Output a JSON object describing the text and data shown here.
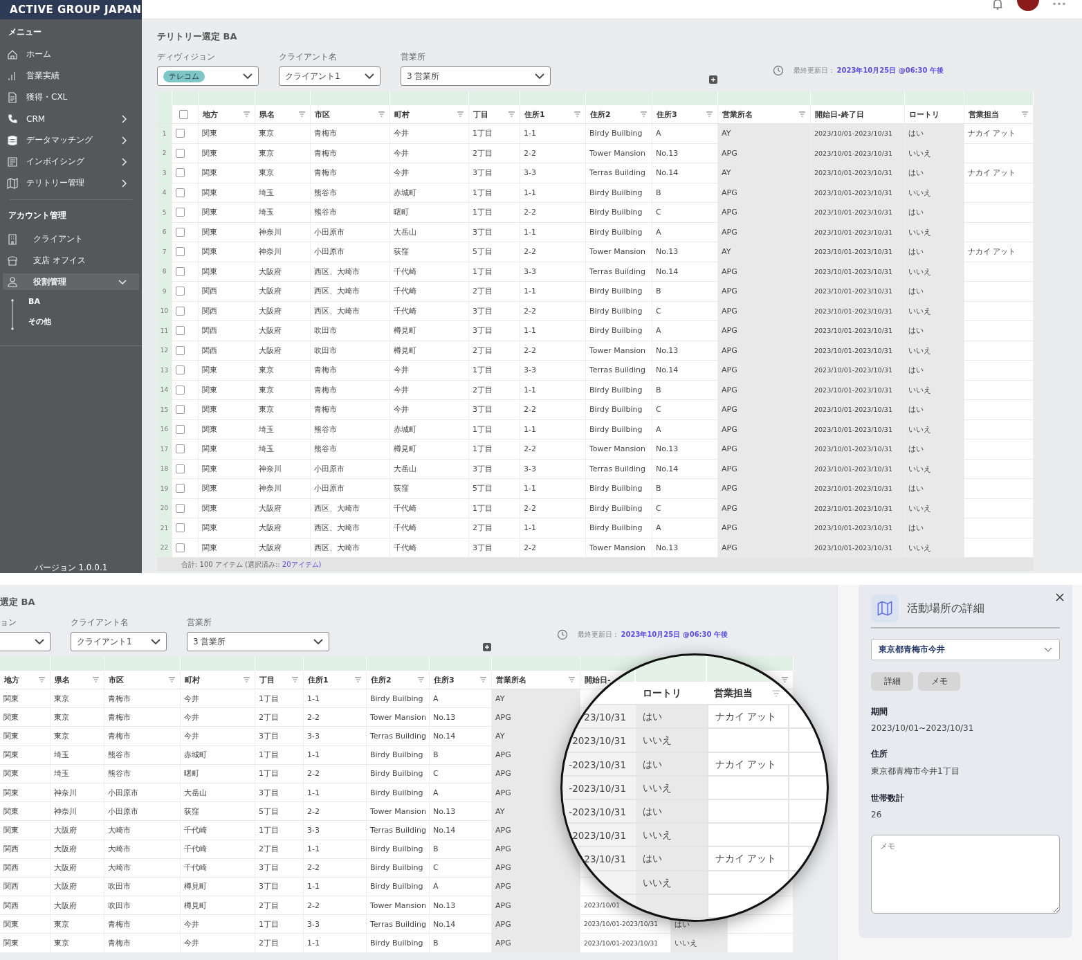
{
  "brand": "ACTIVE GROUP JAPAN",
  "sidebar": {
    "menu_heading": "メニュー",
    "items": [
      {
        "label": "ホーム",
        "expandable": false
      },
      {
        "label": "営業実績",
        "expandable": false
      },
      {
        "label": "獲得・CXL",
        "expandable": false
      },
      {
        "label": "CRM",
        "expandable": true
      },
      {
        "label": "データマッチング",
        "expandable": true
      },
      {
        "label": "インボイシング",
        "expandable": true
      },
      {
        "label": "テリトリー管理",
        "expandable": true
      }
    ],
    "account_heading": "アカウント管理",
    "account_items": [
      {
        "label": "クライアント",
        "expanded": false
      },
      {
        "label": "支店 オフイス",
        "expanded": false
      },
      {
        "label": "役割管理",
        "expanded": true,
        "children": [
          {
            "label": "BA"
          },
          {
            "label": "その他"
          }
        ]
      }
    ],
    "version": "バージョン 1.0.0.1"
  },
  "main": {
    "page_title": "テリトリー選定 BA",
    "filters": [
      {
        "label": "ディヴィジョン",
        "kind": "tag",
        "value": "テレコム"
      },
      {
        "label": "クライアント名",
        "kind": "text",
        "value": "クライアント1"
      },
      {
        "label": "営業所",
        "kind": "text",
        "value": "3 営業所"
      }
    ],
    "updated_label": "最終更新日 :",
    "updated_value": "2023年10月25日 @06:30 午後",
    "columns": [
      {
        "label": "地方",
        "filter": true
      },
      {
        "label": "県名",
        "filter": true
      },
      {
        "label": "市区",
        "filter": true
      },
      {
        "label": "町村",
        "filter": true
      },
      {
        "label": "丁目",
        "filter": true
      },
      {
        "label": "住所1",
        "filter": true
      },
      {
        "label": "住所2",
        "filter": true
      },
      {
        "label": "住所3",
        "filter": true
      },
      {
        "label": "営業所名",
        "filter": true
      },
      {
        "label": "開始日-終了日",
        "filter": false
      },
      {
        "label": "ロートリ",
        "filter": false
      },
      {
        "label": "営業担当",
        "filter": true
      }
    ],
    "rows": [
      {
        "no": "1",
        "checked": false,
        "cells": [
          "関東",
          "東京",
          "青梅市",
          "今井",
          "1丁目",
          "1-1",
          "Birdy Builbing",
          "A",
          "AY",
          "2023/10/01-2023/10/31",
          "はい"
        ],
        "rep": "ナカイ アット"
      },
      {
        "no": "2",
        "checked": false,
        "cells": [
          "関東",
          "東京",
          "青梅市",
          "今井",
          "2丁目",
          "2-2",
          "Tower Mansion",
          "No.13",
          "APG",
          "2023/10/01-2023/10/31",
          "いいえ"
        ]
      },
      {
        "no": "3",
        "checked": false,
        "cells": [
          "関東",
          "東京",
          "青梅市",
          "今井",
          "3丁目",
          "3-3",
          "Terras Building",
          "No.14",
          "AY",
          "2023/10/01-2023/10/31",
          "はい"
        ],
        "rep": "ナカイ アット"
      },
      {
        "no": "4",
        "checked": false,
        "cells": [
          "関東",
          "埼玉",
          "熊谷市",
          "赤城町",
          "1丁目",
          "1-1",
          "Birdy Builbing",
          "B",
          "APG",
          "2023/10/01-2023/10/31",
          "いいえ"
        ]
      },
      {
        "no": "5",
        "checked": false,
        "cells": [
          "関東",
          "埼玉",
          "熊谷市",
          "曙町",
          "1丁目",
          "2-2",
          "Birdy Builbing",
          "C",
          "APG",
          "2023/10/01-2023/10/31",
          "はい"
        ]
      },
      {
        "no": "6",
        "checked": false,
        "cells": [
          "関東",
          "神奈川",
          "小田原市",
          "大岳山",
          "3丁目",
          "1-1",
          "Birdy Builbing",
          "A",
          "APG",
          "2023/10/01-2023/10/31",
          "いいえ"
        ]
      },
      {
        "no": "7",
        "checked": false,
        "cells": [
          "関東",
          "神奈川",
          "小田原市",
          "荻窪",
          "5丁目",
          "2-2",
          "Tower Mansion",
          "No.13",
          "AY",
          "2023/10/01-2023/10/31",
          "はい"
        ],
        "rep": "ナカイ アット"
      },
      {
        "no": "8",
        "checked": false,
        "cells": [
          "関東",
          "大阪府",
          "西区、大崎市",
          "千代崎",
          "1丁目",
          "3-3",
          "Terras Building",
          "No.14",
          "APG",
          "2023/10/01-2023/10/31",
          "いいえ"
        ]
      },
      {
        "no": "9",
        "checked": false,
        "cells": [
          "関西",
          "大阪府",
          "西区、大崎市",
          "千代崎",
          "2丁目",
          "1-1",
          "Birdy Builbing",
          "B",
          "APG",
          "2023/10/01-2023/10/31",
          "はい"
        ]
      },
      {
        "no": "10",
        "checked": false,
        "cells": [
          "関西",
          "大阪府",
          "西区、大崎市",
          "千代崎",
          "3丁目",
          "2-2",
          "Birdy Builbing",
          "C",
          "APG",
          "2023/10/01-2023/10/31",
          "いいえ"
        ]
      },
      {
        "no": "11",
        "checked": false,
        "cells": [
          "関西",
          "大阪府",
          "吹田市",
          "樽見町",
          "3丁目",
          "1-1",
          "Birdy Builbing",
          "A",
          "APG",
          "2023/10/01-2023/10/31",
          "はい"
        ]
      },
      {
        "no": "12",
        "checked": false,
        "cells": [
          "関西",
          "大阪府",
          "吹田市",
          "樽見町",
          "2丁目",
          "2-2",
          "Tower Mansion",
          "No.13",
          "APG",
          "2023/10/01-2023/10/31",
          "いいえ"
        ]
      },
      {
        "no": "13",
        "checked": false,
        "cells": [
          "関東",
          "東京",
          "青梅市",
          "今井",
          "1丁目",
          "3-3",
          "Terras Building",
          "No.14",
          "APG",
          "2023/10/01-2023/10/31",
          "はい"
        ]
      },
      {
        "no": "14",
        "checked": false,
        "cells": [
          "関東",
          "東京",
          "青梅市",
          "今井",
          "2丁目",
          "1-1",
          "Birdy Builbing",
          "B",
          "APG",
          "2023/10/01-2023/10/31",
          "いいえ"
        ]
      },
      {
        "no": "15",
        "checked": false,
        "cells": [
          "関東",
          "東京",
          "青梅市",
          "今井",
          "3丁目",
          "2-2",
          "Birdy Builbing",
          "C",
          "APG",
          "2023/10/01-2023/10/31",
          "はい"
        ]
      },
      {
        "no": "16",
        "checked": false,
        "cells": [
          "関東",
          "埼玉",
          "熊谷市",
          "赤城町",
          "1丁目",
          "1-1",
          "Birdy Builbing",
          "A",
          "APG",
          "2023/10/01-2023/10/31",
          "いいえ"
        ]
      },
      {
        "no": "17",
        "checked": false,
        "cells": [
          "関東",
          "埼玉",
          "熊谷市",
          "樽見町",
          "1丁目",
          "2-2",
          "Tower Mansion",
          "No.13",
          "APG",
          "2023/10/01-2023/10/31",
          "はい"
        ]
      },
      {
        "no": "18",
        "checked": false,
        "cells": [
          "関東",
          "神奈川",
          "小田原市",
          "大岳山",
          "3丁目",
          "3-3",
          "Terras Building",
          "No.14",
          "APG",
          "2023/10/01-2023/10/31",
          "いいえ"
        ]
      },
      {
        "no": "19",
        "checked": false,
        "cells": [
          "関東",
          "神奈川",
          "小田原市",
          "荻窪",
          "5丁目",
          "1-1",
          "Birdy Builbing",
          "B",
          "APG",
          "2023/10/01-2023/10/31",
          "はい"
        ]
      },
      {
        "no": "20",
        "checked": false,
        "cells": [
          "関東",
          "大阪府",
          "西区、大崎市",
          "千代崎",
          "1丁目",
          "2-2",
          "Birdy Builbing",
          "C",
          "APG",
          "2023/10/01-2023/10/31",
          "いいえ"
        ]
      },
      {
        "no": "21",
        "checked": false,
        "cells": [
          "関東",
          "大阪府",
          "西区、大崎市",
          "千代崎",
          "2丁目",
          "1-1",
          "Birdy Builbing",
          "A",
          "APG",
          "2023/10/01-2023/10/31",
          "はい"
        ]
      },
      {
        "no": "22",
        "checked": false,
        "cells": [
          "関東",
          "大阪府",
          "西区、大崎市",
          "千代崎",
          "3丁目",
          "2-2",
          "Tower Mansion",
          "No.13",
          "APG",
          "2023/10/01-2023/10/31",
          "いいえ"
        ]
      }
    ],
    "select_all_checked": false,
    "footer_text": "合計: 100 アイテム (選択済み::",
    "footer_link": "20アイテム)"
  },
  "detail_view": {
    "page_title": "選定 BA",
    "filters": [
      {
        "label": "ョン",
        "kind": "text"
      },
      {
        "label": "クライアント名",
        "kind": "text",
        "value": "クライアント1"
      },
      {
        "label": "営業所",
        "kind": "text",
        "value": "3 営業所"
      }
    ],
    "updated_label": "最終更新日 :",
    "updated_value": "2023年10月25日 @06:30 午後",
    "columns": [
      {
        "label": "地方",
        "filter": true
      },
      {
        "label": "県名",
        "filter": true
      },
      {
        "label": "市区",
        "filter": true
      },
      {
        "label": "町村",
        "filter": true
      },
      {
        "label": "丁目",
        "filter": true
      },
      {
        "label": "住所1",
        "filter": true
      },
      {
        "label": "住所2",
        "filter": true
      },
      {
        "label": "住所3",
        "filter": true
      },
      {
        "label": "営業所名",
        "filter": true
      }
    ],
    "date_header": "開始日-",
    "rows": [
      {
        "cells": [
          "関東",
          "東京",
          "青梅市",
          "今井",
          "1丁目",
          "1-1",
          "Birdy Builbing",
          "A",
          "AY"
        ]
      },
      {
        "cells": [
          "関東",
          "東京",
          "青梅市",
          "今井",
          "2丁目",
          "2-2",
          "Tower Mansion",
          "No.13",
          "APG"
        ]
      },
      {
        "cells": [
          "関東",
          "東京",
          "青梅市",
          "今井",
          "3丁目",
          "3-3",
          "Terras Building",
          "No.14",
          "AY"
        ]
      },
      {
        "cells": [
          "関東",
          "埼玉",
          "熊谷市",
          "赤城町",
          "1丁目",
          "1-1",
          "Birdy Builbing",
          "B",
          "APG"
        ]
      },
      {
        "cells": [
          "関東",
          "埼玉",
          "熊谷市",
          "曙町",
          "1丁目",
          "2-2",
          "Birdy Builbing",
          "C",
          "APG"
        ]
      },
      {
        "cells": [
          "関東",
          "神奈川",
          "小田原市",
          "大岳山",
          "3丁目",
          "1-1",
          "Birdy Builbing",
          "A",
          "APG"
        ]
      },
      {
        "cells": [
          "関東",
          "神奈川",
          "小田原市",
          "荻窪",
          "5丁目",
          "2-2",
          "Tower Mansion",
          "No.13",
          "AY"
        ]
      },
      {
        "cells": [
          "関東",
          "大阪府",
          "大崎市",
          "千代崎",
          "1丁目",
          "3-3",
          "Terras Building",
          "No.14",
          "APG"
        ]
      },
      {
        "cells": [
          "関西",
          "大阪府",
          "大崎市",
          "千代崎",
          "2丁目",
          "1-1",
          "Birdy Builbing",
          "B",
          "APG"
        ]
      },
      {
        "cells": [
          "関西",
          "大阪府",
          "大崎市",
          "千代崎",
          "3丁目",
          "2-2",
          "Birdy Builbing",
          "C",
          "APG"
        ]
      },
      {
        "cells": [
          "関西",
          "大阪府",
          "吹田市",
          "樽見町",
          "3丁目",
          "1-1",
          "Birdy Builbing",
          "A",
          "APG"
        ]
      },
      {
        "cells": [
          "関西",
          "大阪府",
          "吹田市",
          "樽見町",
          "2丁目",
          "2-2",
          "Tower Mansion",
          "No.13",
          "APG"
        ],
        "date": "2023/10/01"
      },
      {
        "cells": [
          "関東",
          "東京",
          "青梅市",
          "今井",
          "1丁目",
          "3-3",
          "Terras Building",
          "No.14",
          "APG"
        ],
        "date": "2023/10/01-2023/10/31",
        "lottery": "はい"
      },
      {
        "cells": [
          "関東",
          "東京",
          "青梅市",
          "今井",
          "2丁目",
          "1-1",
          "Birdy Builbing",
          "B",
          "APG"
        ],
        "date": "2023/10/01-2023/10/31",
        "lottery": "いいえ"
      }
    ],
    "magnifier": {
      "columns": [
        "ロートリ",
        "営業担当"
      ],
      "rows": [
        {
          "date": "23/10/31",
          "lottery": "はい",
          "rep": "ナカイ アット"
        },
        {
          "date": "2023/10/31",
          "lottery": "いいえ"
        },
        {
          "date": "-2023/10/31",
          "lottery": "はい",
          "rep": "ナカイ アット"
        },
        {
          "date": "-2023/10/31",
          "lottery": "いいえ"
        },
        {
          "date": "-2023/10/31",
          "lottery": "はい"
        },
        {
          "date": "2023/10/31",
          "lottery": "いいえ"
        },
        {
          "date": "23/10/31",
          "lottery": "はい",
          "rep": "ナカイ アット"
        },
        {
          "lottery": "いいえ"
        }
      ]
    }
  },
  "panel": {
    "title": "活動場所の詳細",
    "location": "東京都青梅市今井",
    "buttons": [
      "詳細",
      "メモ"
    ],
    "fields": [
      {
        "label": "期間",
        "value": "2023/10/01~2023/10/31"
      },
      {
        "label": "住所",
        "value": "東京都青梅市今井1丁目"
      },
      {
        "label": "世帯数計",
        "value": "26"
      }
    ],
    "memo_placeholder": "メモ"
  }
}
